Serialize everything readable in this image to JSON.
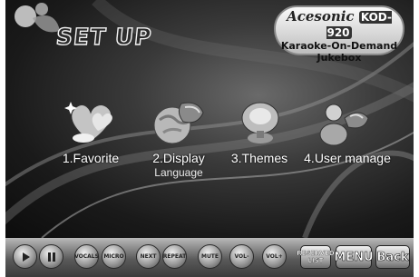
{
  "screen": {
    "title": "SET UP"
  },
  "brand": {
    "logo": "Acesonic",
    "model": "KOD-920",
    "line1": "Karaoke-On-Demand",
    "line2": "Jukebox"
  },
  "menu": {
    "favorite": {
      "label": "1.Favorite",
      "icon": "hearts-icon"
    },
    "display": {
      "label": "2.Display",
      "sub": "Language",
      "icon": "globe-icon"
    },
    "themes": {
      "label": "3.Themes",
      "icon": "themes-icon"
    },
    "user_manage": {
      "label": "4.User manage",
      "icon": "users-icon"
    }
  },
  "toolbar": {
    "buttons": {
      "play": {
        "icon": "play-icon"
      },
      "pause": {
        "icon": "pause-icon"
      },
      "vocal": "VOCALS",
      "mic": "MICRO",
      "next": "NEXT",
      "repeat": "REPEAT",
      "mute": "MUTE",
      "vol_down": "VOL-",
      "vol_up": "VOL+",
      "reserved": "RESERVED LIST",
      "menu": "MENU",
      "back": "Back"
    }
  }
}
